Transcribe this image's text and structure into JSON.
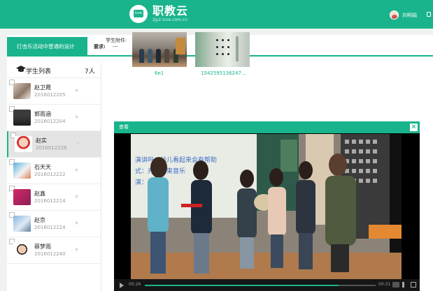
{
  "header": {
    "brand": "职教云",
    "domain": "zjy2.icve.com.cn",
    "logo_badge": "icve",
    "user_name": "刘明娟"
  },
  "task": {
    "tab_label": "打击乐活动中普通的设计",
    "requirement_label": "要求:",
    "requirement_value": "---"
  },
  "student_list": {
    "title": "学生列表",
    "count": "7人",
    "students": [
      {
        "name": "赵卫霞",
        "id": "2016012205"
      },
      {
        "name": "郭雨涵",
        "id": "2016012204"
      },
      {
        "name": "赵实",
        "id": "2016012228"
      },
      {
        "name": "石天天",
        "id": "2016012222"
      },
      {
        "name": "赵鑫",
        "id": "2016012214"
      },
      {
        "name": "赵京",
        "id": "2016012224"
      },
      {
        "name": "蔡梦雨",
        "id": "2016012240"
      }
    ]
  },
  "attachments": {
    "label": "学生附件:",
    "files": [
      {
        "caption": "6e1"
      },
      {
        "caption": "1542595136247..."
      }
    ]
  },
  "video_dialog": {
    "title": "查看",
    "close": "×",
    "time_current": "00:26",
    "time_total": "00:31",
    "progress": 0.84,
    "board_text_1": "演讲吗：幼儿看起来会有帮助",
    "board_text_2": "式：开始结束音乐",
    "board_text_3": "演：演奏"
  },
  "colors": {
    "accent": "#19b48c"
  }
}
